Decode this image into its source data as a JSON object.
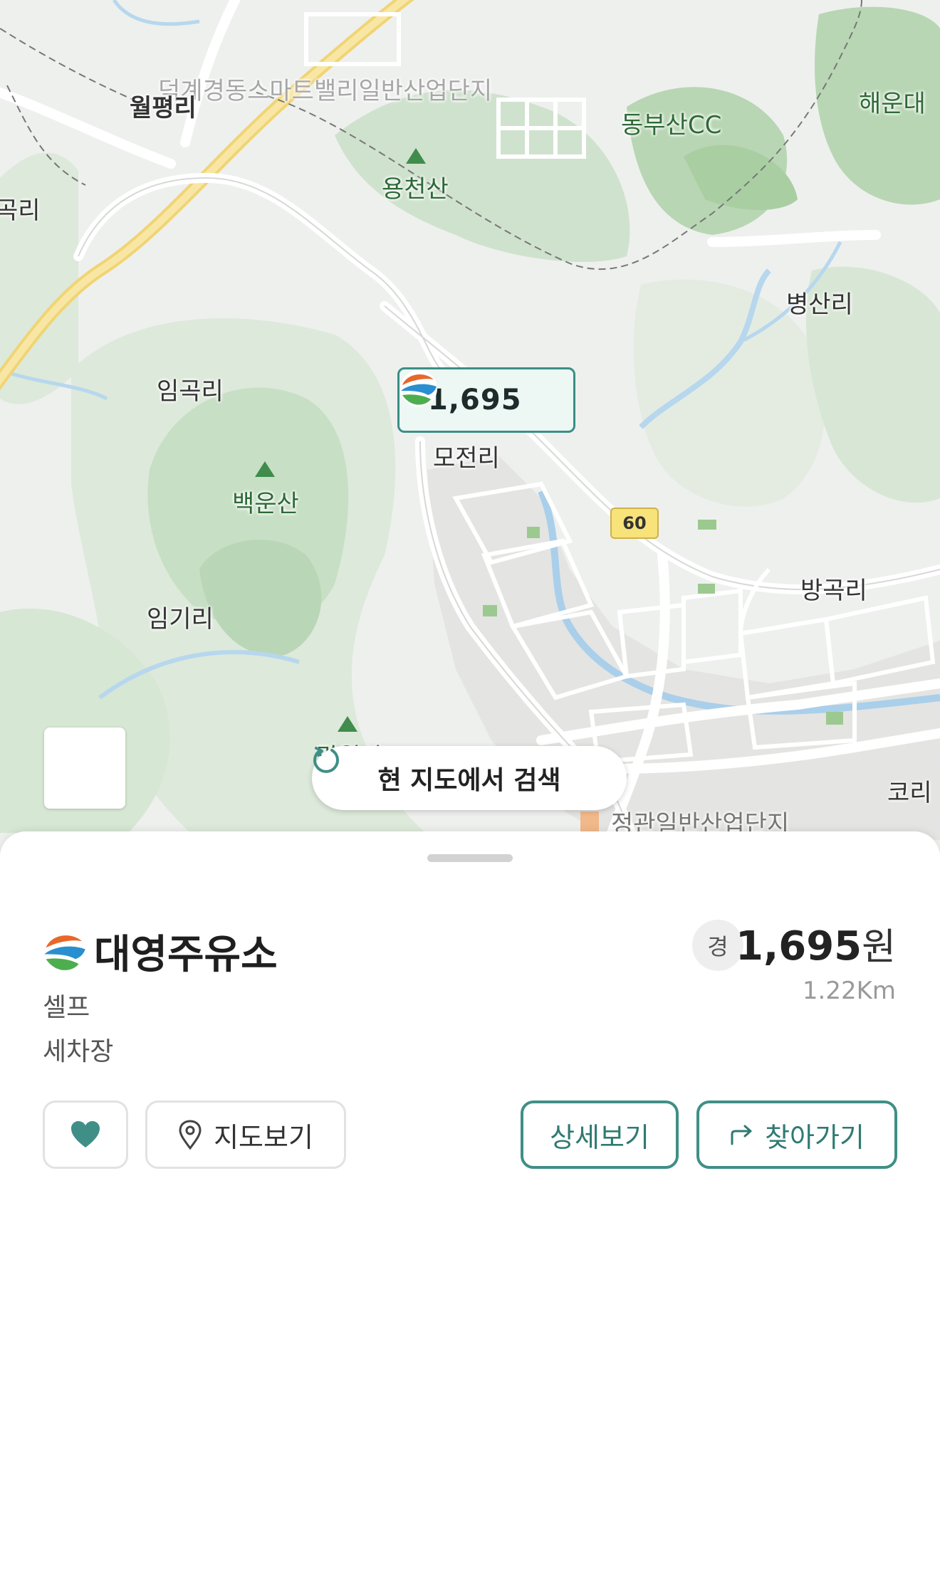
{
  "map": {
    "labels": {
      "industrial_complex_top": "덕계경동스마트밸리일반산업단지",
      "wolpyeong": "월평리",
      "left_edge": "곡리",
      "yongcheonsan": "용천산",
      "dongbusan_cc": "동부산CC",
      "haeundae": "해운대",
      "byeongsan": "병산리",
      "imgok": "임곡리",
      "mojeon": "모전리",
      "baegunsan": "백운산",
      "imgi": "임기리",
      "banggok": "방곡리",
      "bottom_industrial": "정관일반산업단지",
      "bottom_right": "코리",
      "mountain_partial": "망월산"
    },
    "road_number": "60",
    "marker": {
      "price": "1,695",
      "logo_icon": "gas-station-logo-icon"
    },
    "search_here_label": "현 지도에서 검색"
  },
  "station": {
    "name": "대영주유소",
    "tags": [
      "셀프",
      "세차장"
    ],
    "fuel_type_badge": "경",
    "price": "1,695",
    "price_unit": "원",
    "distance": "1.22Km"
  },
  "actions": {
    "view_map_label": "지도보기",
    "detail_label": "상세보기",
    "navigate_label": "찾아가기"
  },
  "colors": {
    "accent": "#3f8f86",
    "marker_border": "#3a8f85",
    "map_green": "#cfe2cd",
    "favorite_heart": "#3f8f86"
  }
}
